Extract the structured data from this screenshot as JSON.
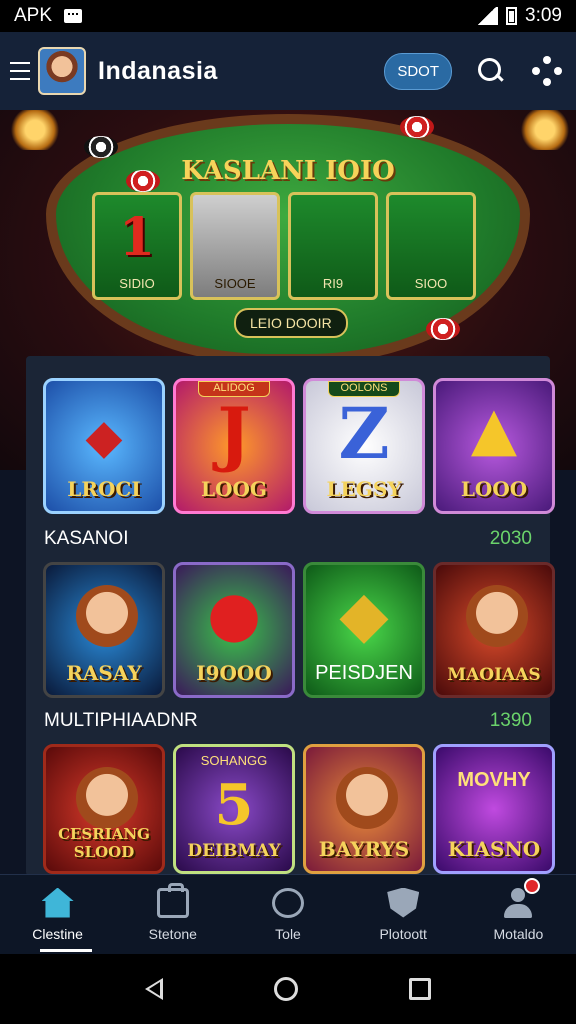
{
  "status_bar": {
    "carrier": "APK",
    "time": "3:09"
  },
  "app_bar": {
    "title": "Indanasia",
    "pill_label": "SDOT"
  },
  "hero": {
    "title": "KASLANI IOIO",
    "cards": [
      {
        "glyph": "1",
        "label": "SIDIO"
      },
      {
        "glyph": "",
        "label": "SIOOE"
      },
      {
        "glyph": "",
        "label": "RI9"
      },
      {
        "glyph": "",
        "label": "SIOO"
      }
    ],
    "button_label": "LEIO DOOIR"
  },
  "grid_top": [
    {
      "label": "LROCI",
      "tag": ""
    },
    {
      "label": "LOOG",
      "tag": "ALIDOG"
    },
    {
      "label": "LEGSY",
      "tag": "OOLONS"
    },
    {
      "label": "LOOO",
      "tag": ""
    }
  ],
  "section1": {
    "title": "KASANOI",
    "count": "2030"
  },
  "grid_mid": [
    {
      "label": "RASAY"
    },
    {
      "label": "I9OOO"
    },
    {
      "label": "PEISDJEN"
    },
    {
      "label": "MAOIAAS"
    }
  ],
  "section2": {
    "title": "MULTIPHIAADNR",
    "count": "1390"
  },
  "grid_bottom": [
    {
      "label": "CESRIANG SLOOD"
    },
    {
      "label": "DEIBMAY",
      "tag": "SOHANGG"
    },
    {
      "label": "BAYRYS"
    },
    {
      "label": "KIASNO",
      "tag": "MOVHY"
    }
  ],
  "bottom_nav": [
    {
      "label": "Clestine",
      "icon": "home-icon"
    },
    {
      "label": "Stetone",
      "icon": "bag-icon"
    },
    {
      "label": "Tole",
      "icon": "chat-icon"
    },
    {
      "label": "Plotoott",
      "icon": "shield-icon"
    },
    {
      "label": "Motaldo",
      "icon": "user-icon"
    }
  ],
  "colors": {
    "accent": "#3fb6d8",
    "count_green": "#6bd36b",
    "gold": "#f5d35c"
  }
}
